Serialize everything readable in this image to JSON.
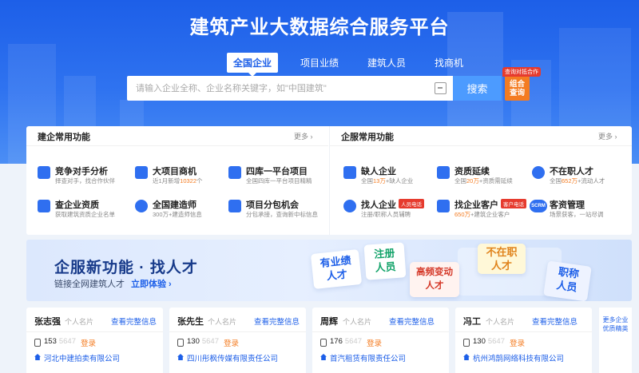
{
  "hero": {
    "title": "建筑产业大数据综合服务平台",
    "tabs": [
      {
        "label": "全国企业",
        "active": true
      },
      {
        "label": "项目业绩",
        "active": false
      },
      {
        "label": "建筑人员",
        "active": false
      },
      {
        "label": "找商机",
        "active": false
      }
    ],
    "search": {
      "placeholder": "请输入企业全称、企业名称关键字，如\"中国建筑\"",
      "value": "",
      "button": "搜索"
    },
    "combo": {
      "line1": "组合",
      "line2": "查询",
      "tag": "查询对抵合作"
    }
  },
  "panels": {
    "left": {
      "title": "建企常用功能",
      "more": "更多 ›",
      "items": [
        {
          "title": "竞争对手分析",
          "sub": "择查对手，找合作伙伴",
          "icon": "analysis-icon"
        },
        {
          "title": "大项目商机",
          "sub_pre": "近1月新增",
          "sub_hl": "10322",
          "sub_post": "个",
          "icon": "building-icon"
        },
        {
          "title": "四库一平台项目",
          "sub": "全国四库一平台项目精精",
          "icon": "bar-chart-icon"
        },
        {
          "title": "查企业资质",
          "sub": "获取建筑资质企业名单",
          "icon": "company-icon"
        },
        {
          "title": "全国建造师",
          "sub": "300万+建造师信息",
          "icon": "user-icon"
        },
        {
          "title": "项目分包机会",
          "sub": "分包承接，查询新中标信息",
          "icon": "document-check-icon"
        }
      ]
    },
    "right": {
      "title": "企服常用功能",
      "more": "更多 ›",
      "items": [
        {
          "title": "缺人企业",
          "sub_pre": "全国",
          "sub_hl": "13万",
          "sub_post": "+缺人企业",
          "icon": "building-search-icon"
        },
        {
          "title": "资质延续",
          "sub_pre": "全国",
          "sub_hl": "20万",
          "sub_post": "+资质需延续",
          "icon": "certificate-icon"
        },
        {
          "title": "不在职人才",
          "sub_pre": "全国",
          "sub_hl": "652万",
          "sub_post": "+流动人才",
          "icon": "person-icon"
        },
        {
          "title": "找人企业",
          "badge": "人员电话",
          "sub": "注册/职称人员辅聘",
          "icon": "person-search-icon"
        },
        {
          "title": "找企业客户",
          "badge": "客户电话",
          "sub_pre": "",
          "sub_hl": "650万",
          "sub_post": "+建筑企业客户",
          "icon": "customer-icon"
        },
        {
          "title": "客资管理",
          "sub": "场景获客，一站尽调",
          "icon": "scrm-icon",
          "icon_text": "SCRM"
        }
      ]
    }
  },
  "banner": {
    "title": "企服新功能 · 找人才",
    "sub": "链接全网建筑人才",
    "link": "立即体验 ›",
    "chips": [
      "有业绩\n人才",
      "注册\n人员",
      "高频变动\n人才",
      "不在职\n人才",
      "职称\n人员"
    ]
  },
  "people": [
    {
      "name": "张志强",
      "type": "个人名片",
      "link": "查看完整信息",
      "phone": "153",
      "phone_masked": "5647",
      "login": "登录",
      "company": "河北中建拍卖有限公司"
    },
    {
      "name": "张先生",
      "type": "个人名片",
      "link": "查看完整信息",
      "phone": "130",
      "phone_masked": "5647",
      "login": "登录",
      "company": "四川彤枫传媒有限责任公司"
    },
    {
      "name": "周辉",
      "type": "个人名片",
      "link": "查看完整信息",
      "phone": "176",
      "phone_masked": "5647",
      "login": "登录",
      "company": "首汽租赁有限责任公司"
    },
    {
      "name": "冯工",
      "type": "个人名片",
      "link": "查看完整信息",
      "phone": "130",
      "phone_masked": "5647",
      "login": "登录",
      "company": "杭州鸿鹄网络科技有限公司"
    }
  ],
  "side_more": {
    "text": "更多企业优质精英"
  }
}
